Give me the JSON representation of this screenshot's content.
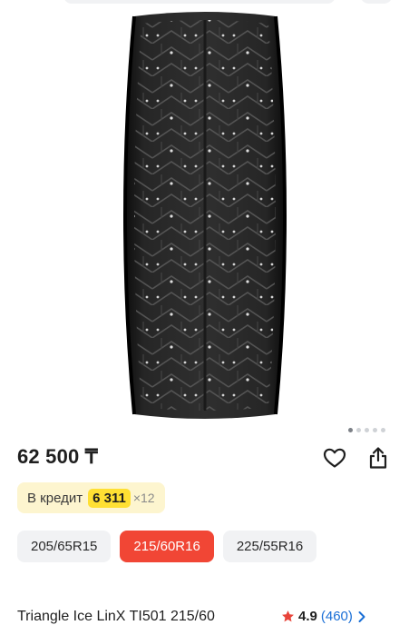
{
  "product": {
    "image_alt": "tire",
    "gallery": {
      "slide_count": 5,
      "active_index": 0
    },
    "price": "62 500 ₸",
    "credit": {
      "label": "В кредит",
      "amount": "6 311",
      "term": "×12"
    },
    "sizes": [
      {
        "label": "205/65R15",
        "selected": false
      },
      {
        "label": "215/60R16",
        "selected": true
      },
      {
        "label": "225/55R16",
        "selected": false
      }
    ],
    "title": "Triangle Ice LinX TI501 215/60",
    "rating": {
      "value": "4.9",
      "count": "(460)"
    }
  },
  "colors": {
    "accent": "#f14635",
    "credit_bg": "#fdf5cf",
    "credit_highlight": "#ffe033",
    "link": "#1a6fd6",
    "star": "#e8443a"
  },
  "icons": {
    "favorite": "heart-icon",
    "share": "share-icon",
    "rating": "star-icon",
    "more": "chevron-right-icon"
  }
}
